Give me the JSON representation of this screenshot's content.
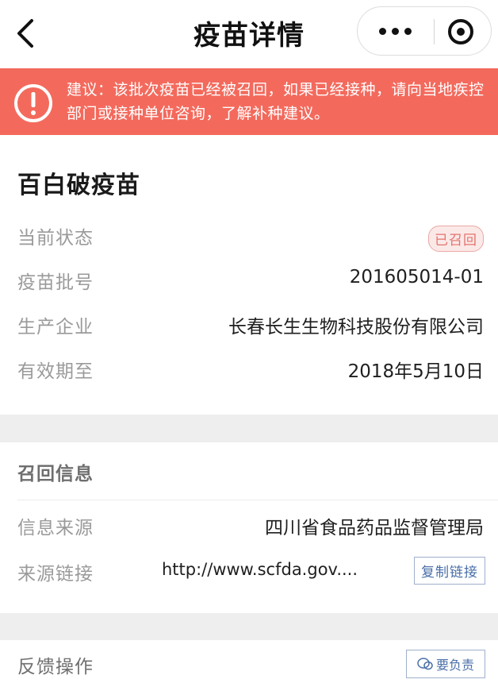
{
  "nav": {
    "title": "疫苗详情",
    "back_icon": "chevron-left-icon",
    "more_icon": "more-dots-icon",
    "close_icon": "target-close-icon"
  },
  "banner": {
    "icon": "exclamation-circle-icon",
    "text": "建议：该批次疫苗已经被召回，如果已经接种，请向当地疾控部门或接种单位咨询，了解补种建议。",
    "color": "#f36a5d"
  },
  "vaccine": {
    "name": "百白破疫苗",
    "rows": [
      {
        "label": "当前状态",
        "badge": "已召回"
      },
      {
        "label": "疫苗批号",
        "value": "201605014-01"
      },
      {
        "label": "生产企业",
        "value": "长春长生生物科技股份有限公司"
      },
      {
        "label": "有效期至",
        "value": "2018年5月10日"
      }
    ]
  },
  "recall": {
    "title": "召回信息",
    "source_label": "信息来源",
    "source_value": "四川省食品药品监督管理局",
    "link_label": "来源链接",
    "link_value": "http://www.scfda.gov....",
    "copy_button": "复制链接"
  },
  "feedback": {
    "label": "反馈操作",
    "button_text": "要负责",
    "button_icon": "watermark-logo-icon"
  },
  "colors": {
    "badge_border": "#e9a8a4",
    "badge_text": "#e3746d",
    "link_button": "#4a6fa8"
  }
}
